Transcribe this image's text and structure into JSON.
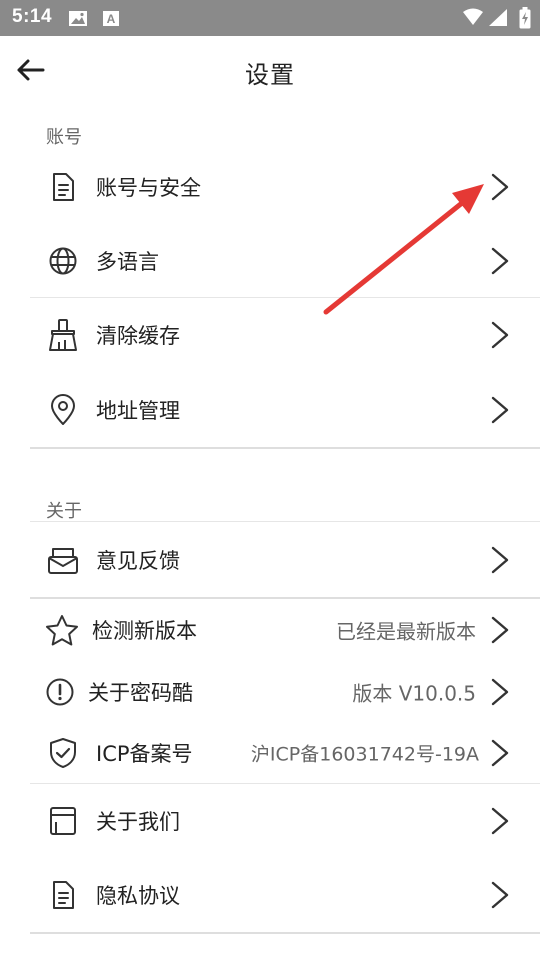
{
  "status_bar": {
    "time": "5:14",
    "icons": [
      "image-icon",
      "a-notification-icon",
      "wifi-icon",
      "signal-icon",
      "battery-icon"
    ]
  },
  "header": {
    "title": "设置",
    "back_icon": "arrow-left-icon"
  },
  "sections": {
    "account": {
      "label": "账号",
      "items": [
        {
          "label": "账号与安全",
          "icon": "document-icon"
        },
        {
          "label": "多语言",
          "icon": "globe-icon"
        },
        {
          "label": "清除缓存",
          "icon": "broom-icon"
        },
        {
          "label": "地址管理",
          "icon": "location-pin-icon"
        }
      ]
    },
    "about": {
      "label": "关于",
      "items": [
        {
          "label": "意见反馈",
          "icon": "mail-box-icon",
          "value": ""
        },
        {
          "label": "检测新版本",
          "icon": "star-icon",
          "value": "已经是最新版本"
        },
        {
          "label": "关于密码酷",
          "icon": "info-circle-icon",
          "value": "版本 V10.0.5"
        },
        {
          "label": "ICP备案号",
          "icon": "shield-check-icon",
          "value": "沪ICP备16031742号-19A"
        },
        {
          "label": "关于我们",
          "icon": "card-icon",
          "value": ""
        },
        {
          "label": "隐私协议",
          "icon": "document-icon",
          "value": ""
        }
      ]
    }
  },
  "colors": {
    "status_bar_bg": "#8a8a8a",
    "annotation_arrow": "#e53935",
    "text_primary": "#222222",
    "text_secondary": "#666666"
  }
}
